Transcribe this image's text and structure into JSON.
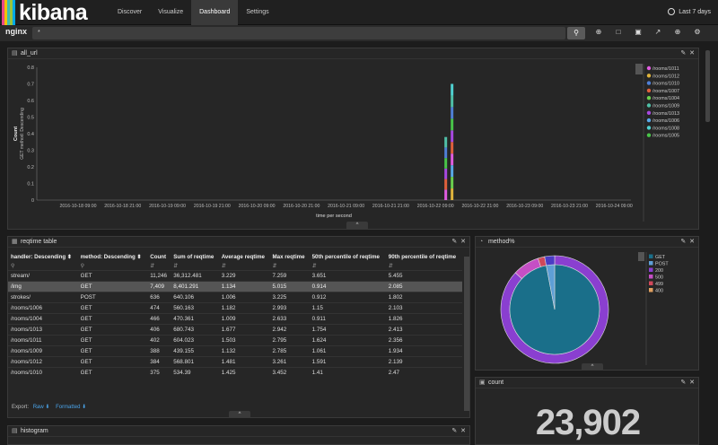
{
  "app": {
    "logo_text": "kibana",
    "logo_colors": [
      "#e8478b",
      "#f0c400",
      "#3ebeb0",
      "#9ac43e",
      "#00a9e5"
    ]
  },
  "nav": {
    "items": [
      "Discover",
      "Visualize",
      "Dashboard",
      "Settings"
    ],
    "active": "Dashboard"
  },
  "timepicker": {
    "label": "Last 7 days"
  },
  "search": {
    "index": "nginx",
    "query": "*"
  },
  "panels": {
    "all_url": {
      "title": "all_url",
      "chart_data": {
        "type": "bar",
        "stacked": true,
        "xlabel": "time per second",
        "ylabel": "Count",
        "ylabel2": "GET method: Descending",
        "ylim": [
          0,
          0.8
        ],
        "yticks": [
          "0",
          "0.1",
          "0.2",
          "0.3",
          "0.4",
          "0.5",
          "0.6",
          "0.7",
          "0.8"
        ],
        "xticks": [
          "2016-10-18 09:00",
          "2016-10-18 21:00",
          "2016-10-19 09:00",
          "2016-10-19 21:00",
          "2016-10-20 09:00",
          "2016-10-20 21:00",
          "2016-10-21 09:00",
          "2016-10-21 21:00",
          "2016-10-22 09:00",
          "2016-10-22 21:00",
          "2016-10-23 09:00",
          "2016-10-23 21:00",
          "2016-10-24 09:00"
        ],
        "bars": [
          {
            "x": "2016-10-22 06:00",
            "total": 0.38
          },
          {
            "x": "2016-10-22 09:00",
            "total": 0.7
          }
        ],
        "legend": [
          {
            "name": "/rooms/1011",
            "color": "#e05ce0"
          },
          {
            "name": "/rooms/1012",
            "color": "#e0b43c"
          },
          {
            "name": "/rooms/1010",
            "color": "#4f7fd6"
          },
          {
            "name": "/rooms/1007",
            "color": "#e0603c"
          },
          {
            "name": "/rooms/1004",
            "color": "#6bd04e"
          },
          {
            "name": "/rooms/1009",
            "color": "#4fbfa7"
          },
          {
            "name": "/rooms/1013",
            "color": "#a848e0"
          },
          {
            "name": "/rooms/1006",
            "color": "#58a8e8"
          },
          {
            "name": "/rooms/1008",
            "color": "#4fd0d0"
          },
          {
            "name": "/rooms/1005",
            "color": "#49c449"
          }
        ]
      }
    },
    "reqtime": {
      "title": "reqtime table",
      "columns": [
        {
          "label": "handler: Descending ⬍"
        },
        {
          "label": "method: Descending ⬍"
        },
        {
          "label": "Count"
        },
        {
          "label": "Sum of reqtime"
        },
        {
          "label": "Average reqtime"
        },
        {
          "label": "Max reqtime"
        },
        {
          "label": "50th percentile of reqtime"
        },
        {
          "label": "90th percentile of reqtime"
        }
      ],
      "rows": [
        [
          "stream/",
          "GET",
          "11,246",
          "36,312.481",
          "3.229",
          "7.259",
          "3.651",
          "5.455"
        ],
        [
          "/img",
          "GET",
          "7,409",
          "8,401.291",
          "1.134",
          "5.015",
          "0.914",
          "2.085"
        ],
        [
          "strokes/",
          "POST",
          "636",
          "640.106",
          "1.006",
          "3.225",
          "0.912",
          "1.802"
        ],
        [
          "/rooms/1006",
          "GET",
          "474",
          "560.163",
          "1.182",
          "2.993",
          "1.15",
          "2.103"
        ],
        [
          "/rooms/1004",
          "GET",
          "466",
          "470.361",
          "1.009",
          "2.633",
          "0.911",
          "1.826"
        ],
        [
          "/rooms/1013",
          "GET",
          "406",
          "680.743",
          "1.677",
          "2.942",
          "1.754",
          "2.413"
        ],
        [
          "/rooms/1011",
          "GET",
          "402",
          "604.023",
          "1.503",
          "2.795",
          "1.624",
          "2.356"
        ],
        [
          "/rooms/1009",
          "GET",
          "388",
          "439.155",
          "1.132",
          "2.785",
          "1.061",
          "1.934"
        ],
        [
          "/rooms/1012",
          "GET",
          "384",
          "568.801",
          "1.481",
          "3.261",
          "1.591",
          "2.139"
        ],
        [
          "/rooms/1010",
          "GET",
          "375",
          "534.39",
          "1.425",
          "3.452",
          "1.41",
          "2.47"
        ]
      ],
      "selected_row": 1,
      "export_label": "Export:",
      "raw_label": "Raw ⬇",
      "formatted_label": "Formatted ⬇"
    },
    "method": {
      "title": "method%",
      "chart_data": {
        "type": "pie",
        "inner": [
          {
            "name": "GET",
            "value": 97,
            "color": "#1a6f8a"
          },
          {
            "name": "POST",
            "value": 3,
            "color": "#5e9fd6"
          }
        ],
        "outer": [
          {
            "name": "200",
            "value": 87,
            "color": "#8a3fd0"
          },
          {
            "name": "500",
            "value": 8,
            "color": "#c54fc5"
          },
          {
            "name": "499",
            "value": 2,
            "color": "#d0485a"
          },
          {
            "name": "400",
            "value": 3,
            "color": "#4a3cc4"
          }
        ],
        "legend": [
          {
            "name": "GET",
            "color": "#1a6f8a"
          },
          {
            "name": "POST",
            "color": "#5e9fd6"
          },
          {
            "name": "200",
            "color": "#8a3fd0"
          },
          {
            "name": "500",
            "color": "#c54fc5"
          },
          {
            "name": "499",
            "color": "#d0485a"
          },
          {
            "name": "400",
            "color": "#e0a060"
          }
        ]
      }
    },
    "count": {
      "title": "count",
      "value": "23,902"
    },
    "histogram": {
      "title": "histogram"
    }
  }
}
